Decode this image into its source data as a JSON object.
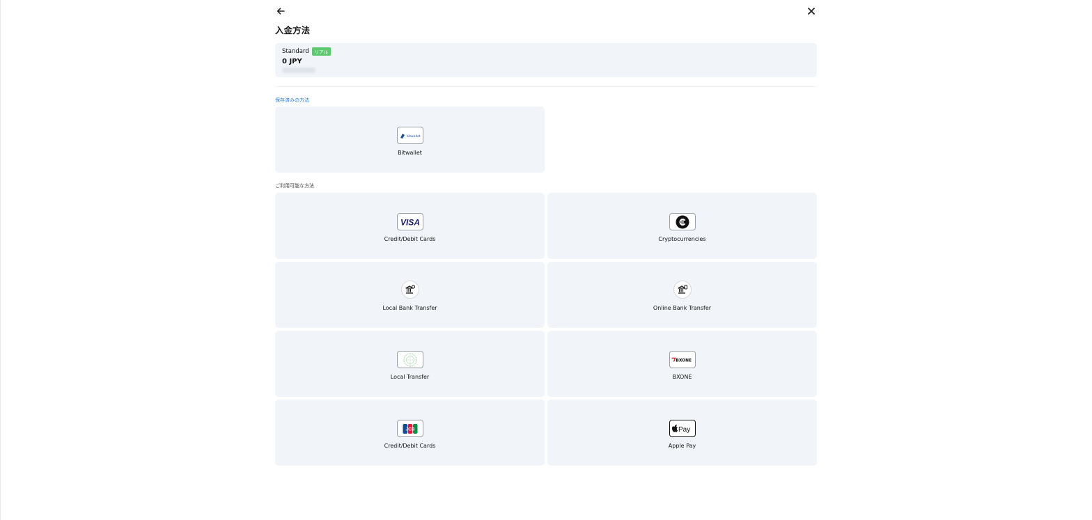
{
  "header": {
    "title": "入金方法"
  },
  "account": {
    "name": "Standard",
    "badge": "リアル",
    "balance": "0 JPY"
  },
  "sections": {
    "saved_label": "保存済みの方法",
    "available_label": "ご利用可能な方法"
  },
  "saved_methods": [
    {
      "label": "Bitwallet",
      "logo_text": "bitwallet"
    }
  ],
  "available_methods": [
    {
      "label": "Credit/Debit Cards",
      "logo_text": "VISA"
    },
    {
      "label": "Cryptocurrencies"
    },
    {
      "label": "Local Bank Transfer"
    },
    {
      "label": "Online Bank Transfer"
    },
    {
      "label": "Local Transfer"
    },
    {
      "label": "BXONE",
      "logo_text": "BXONE"
    },
    {
      "label": "Credit/Debit Cards",
      "logo_text": "JCB"
    },
    {
      "label": "Apple Pay",
      "logo_text": "Pay"
    }
  ],
  "colors": {
    "accent_link": "#2a7ad6",
    "badge_green": "#5cc96f",
    "card_bg": "#f1f4f8"
  }
}
